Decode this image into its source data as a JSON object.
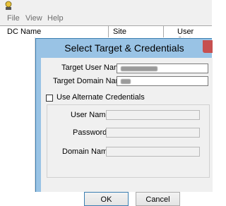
{
  "window": {
    "menu": [
      "File",
      "View",
      "Help"
    ],
    "columns": [
      "DC Name",
      "Site",
      "User State"
    ]
  },
  "dialog": {
    "title": "Select Target & Credentials",
    "target_user_label": "Target User Name:",
    "target_user_value_redacted": true,
    "target_domain_label": "Target Domain Name:",
    "target_domain_value_redacted": true,
    "use_alt_label": "Use Alternate Credentials",
    "use_alt_checked": false,
    "user_name_label": "User Name:",
    "password_label": "Password:",
    "domain_name_label": "Domain Name:",
    "ok_label": "OK",
    "cancel_label": "Cancel"
  },
  "colors": {
    "dialog_frame": "#99c3e5",
    "close_button": "#c75050",
    "client": "#f0f0f0"
  }
}
